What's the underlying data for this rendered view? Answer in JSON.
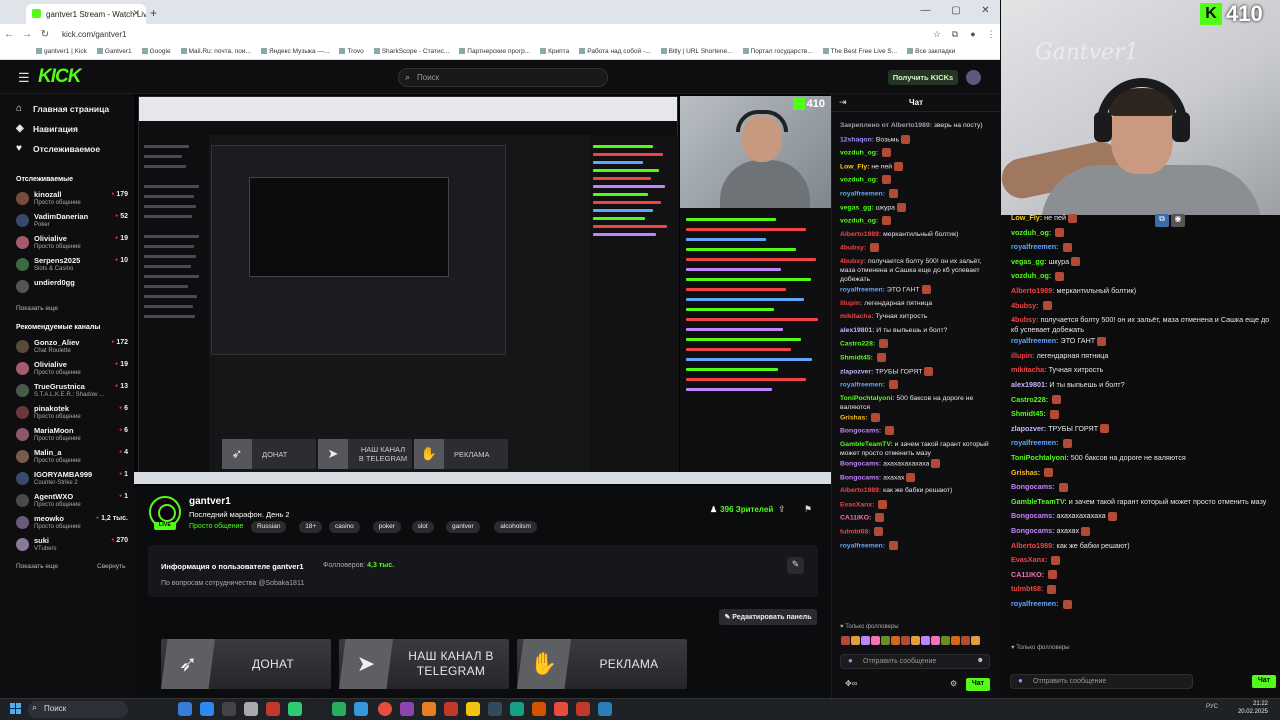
{
  "browser": {
    "tab_title": "gantver1 Stream - Watch Live",
    "new_tab": "+",
    "window_controls": [
      "—",
      "▢",
      "✕"
    ],
    "url": "kick.com/gantver1",
    "bookmarks": [
      "gantver1 | Kick",
      "Gantver1",
      "Google",
      "Mail.Ru: почта, пои...",
      "Яндекс Музыка —...",
      "Trovo",
      "SharkScope - Статис...",
      "Партнерские прогр...",
      "Крипта",
      "Работа над собой -...",
      "Bitly | URL Shortene...",
      "Портал государств...",
      "The Best Free Live S..."
    ],
    "bookmarks_all": "Все закладки"
  },
  "header": {
    "logo": "KICK",
    "search_placeholder": "Поиск",
    "get_kicks": "Получить KICKs"
  },
  "sidebar": {
    "nav": [
      {
        "label": "Главная страница",
        "icon": "home-icon"
      },
      {
        "label": "Навигация",
        "icon": "compass-icon"
      },
      {
        "label": "Отслеживаемое",
        "icon": "heart-icon"
      }
    ],
    "following_title": "Отслеживаемые",
    "following": [
      {
        "name": "kinozall",
        "category": "Просто общение",
        "viewers": "179",
        "color": "#7a4b3a"
      },
      {
        "name": "VadimDanerian",
        "category": "Poker",
        "viewers": "52",
        "color": "#384a6a"
      },
      {
        "name": "Olivialive",
        "category": "Просто общение",
        "viewers": "19",
        "color": "#a65b6d"
      },
      {
        "name": "Serpens2025",
        "category": "Slots & Casino",
        "viewers": "10",
        "color": "#3b6b3e"
      },
      {
        "name": "undierd0gg",
        "category": "",
        "viewers": "",
        "color": "#555555"
      }
    ],
    "show_more_1": "Показать еще",
    "recommended_title": "Рекомендуемые каналы",
    "recommended": [
      {
        "name": "Gonzo_Aliev",
        "category": "Chat Roulette",
        "viewers": "172",
        "color": "#5a4a3a"
      },
      {
        "name": "Olivialive",
        "category": "Просто общение",
        "viewers": "19",
        "color": "#a65b6d"
      },
      {
        "name": "TrueGrustnica",
        "category": "S.T.A.L.K.E.R.: Shadow ...",
        "viewers": "13",
        "color": "#4a5a4a"
      },
      {
        "name": "pinakotek",
        "category": "Просто общение",
        "viewers": "6",
        "color": "#6a3a3a"
      },
      {
        "name": "MariaMoon",
        "category": "Просто общение",
        "viewers": "6",
        "color": "#8a5a6a"
      },
      {
        "name": "Malin_a",
        "category": "Просто общение",
        "viewers": "4",
        "color": "#7a5a4a"
      },
      {
        "name": "IGORYAMBA999",
        "category": "Counter-Strike 2",
        "viewers": "1",
        "color": "#3a4a6a"
      },
      {
        "name": "AgentWXO",
        "category": "Просто общение",
        "viewers": "1",
        "color": "#4a4a4a"
      },
      {
        "name": "meowko",
        "category": "Просто общение",
        "viewers": "1,2 тыс.",
        "color": "#6a5a7a"
      },
      {
        "name": "suki",
        "category": "VTubers",
        "viewers": "270",
        "color": "#8a7a9a"
      }
    ],
    "show_more_2": "Показать еще",
    "collapse": "Свернуть"
  },
  "player": {
    "inner_badge": "410",
    "buttons": [
      "ДОНАТ",
      "НАШ КАНАЛ В TELEGRAM",
      "РЕКЛАМА"
    ]
  },
  "stream": {
    "streamer": "gantver1",
    "title": "Последний марафон. День 2",
    "category": "Просто общение",
    "tags": [
      "Russian",
      "18+",
      "casino",
      "poker",
      "slot",
      "gantver",
      "alcoholism"
    ],
    "viewers": "396 Зрителей",
    "live": "LIVE"
  },
  "about": {
    "title": "Информация о пользователе gantver1",
    "followers_label": "Фолловеров:",
    "followers_value": "4,3 тыс.",
    "description": "По вопросам сотрудничества @Sobaka1811",
    "edit_panel": "Редактировать панель"
  },
  "panels": [
    {
      "label": "ДОНАТ",
      "icon": "wing-icon"
    },
    {
      "label": "НАШ КАНАЛ В TELEGRAM",
      "icon": "telegram-icon"
    },
    {
      "label": "РЕКЛАМА",
      "icon": "handshake-icon"
    }
  ],
  "chat": {
    "title": "Чат",
    "messages": [
      {
        "user": "Закреплено от Alberto1989:",
        "text": "зверь на посту)",
        "color": "#9aa0a6"
      },
      {
        "user": "12shaqon:",
        "text": "Возьмь",
        "color": "#a78bfa"
      },
      {
        "user": "vozduh_og:",
        "text": "",
        "color": "#53fc18"
      },
      {
        "user": "Low_Fly:",
        "text": "не пей",
        "color": "#facc15"
      },
      {
        "user": "vozduh_og:",
        "text": "",
        "color": "#53fc18"
      },
      {
        "user": "royalfreemen:",
        "text": "",
        "color": "#60a5fa"
      },
      {
        "user": "vegas_gg:",
        "text": "шкура",
        "color": "#53fc18"
      },
      {
        "user": "vozduh_og:",
        "text": "",
        "color": "#53fc18"
      },
      {
        "user": "Alberto1989:",
        "text": "меркантильный болтик)",
        "color": "#ef4444"
      },
      {
        "user": "4bubsy:",
        "text": "",
        "color": "#ef4444"
      },
      {
        "user": "4bubsy:",
        "text": "получается болту 500! он их зальёт, маза отменена и Сашка еще до кб успевает добежать",
        "color": "#ef4444"
      },
      {
        "user": "royalfreemen:",
        "text": "ЭТО ГАНТ",
        "color": "#60a5fa"
      },
      {
        "user": "illupin:",
        "text": "легендарная пятница",
        "color": "#ef4444"
      },
      {
        "user": "mikitacha:",
        "text": "Тучная хитрость",
        "color": "#ef4444"
      },
      {
        "user": "alex19801:",
        "text": "И ты выпьешь и болт?",
        "color": "#c4b5fd"
      },
      {
        "user": "Castro228:",
        "text": "",
        "color": "#53fc18"
      },
      {
        "user": "Shmidt45:",
        "text": "",
        "color": "#53fc18"
      },
      {
        "user": "zlapozver:",
        "text": "ТРУБЫ ГОРЯТ",
        "color": "#c4b5fd"
      },
      {
        "user": "royalfreemen:",
        "text": "",
        "color": "#60a5fa"
      },
      {
        "user": "ToniPochtalyoni:",
        "text": "500 баксов на дороге не валяются",
        "color": "#53fc18"
      },
      {
        "user": "Grishas:",
        "text": "",
        "color": "#fbbf24"
      },
      {
        "user": "Bongocams:",
        "text": "",
        "color": "#c084fc"
      },
      {
        "user": "GambleTeamTV:",
        "text": "и зачем такой гарант который может просто отменить мазу",
        "color": "#53fc18"
      },
      {
        "user": "Bongocams:",
        "text": "ахахахахахаха",
        "color": "#c084fc"
      },
      {
        "user": "Bongocams:",
        "text": "ахахах",
        "color": "#c084fc"
      },
      {
        "user": "Alberto1989:",
        "text": "как же бабки решают)",
        "color": "#ef4444"
      },
      {
        "user": "EvasXanx:",
        "text": "",
        "color": "#ef4444"
      },
      {
        "user": "CA11IKO:",
        "text": "",
        "color": "#f472b6"
      },
      {
        "user": "tulmbt68:",
        "text": "",
        "color": "#ef4444"
      },
      {
        "user": "royalfreemen:",
        "text": "",
        "color": "#60a5fa"
      }
    ],
    "followers_only": "Только фолловеры",
    "input_placeholder": "Отправить сообщение",
    "send": "Чат"
  },
  "overlay": {
    "counter": "410",
    "watermark": "Gantver1",
    "messages": [
      {
        "user": "Low_Fly:",
        "text": "не пей",
        "color": "#facc15"
      },
      {
        "user": "vozduh_og:",
        "text": "",
        "color": "#53fc18"
      },
      {
        "user": "royalfreemen:",
        "text": "",
        "color": "#60a5fa"
      },
      {
        "user": "vegas_gg:",
        "text": "шкура",
        "color": "#53fc18"
      },
      {
        "user": "vozduh_og:",
        "text": "",
        "color": "#53fc18"
      },
      {
        "user": "Alberto1989:",
        "text": "меркантильный болтик)",
        "color": "#ef4444"
      },
      {
        "user": "4bubsy:",
        "text": "",
        "color": "#ef4444"
      },
      {
        "user": "4bubsy:",
        "text": "получается болту 500! он их зальёт, маза отменена и Сашка еще до кб успевает добежать",
        "color": "#ef4444"
      },
      {
        "user": "royalfreemen:",
        "text": "ЭТО ГАНТ",
        "color": "#60a5fa"
      },
      {
        "user": "illupin:",
        "text": "легендарная пятница",
        "color": "#ef4444"
      },
      {
        "user": "mikitacha:",
        "text": "Тучная хитрость",
        "color": "#ef4444"
      },
      {
        "user": "alex19801:",
        "text": "И ты выпьешь и болт?",
        "color": "#c4b5fd"
      },
      {
        "user": "Castro228:",
        "text": "",
        "color": "#53fc18"
      },
      {
        "user": "Shmidt45:",
        "text": "",
        "color": "#53fc18"
      },
      {
        "user": "zlapozver:",
        "text": "ТРУБЫ ГОРЯТ",
        "color": "#c4b5fd"
      },
      {
        "user": "royalfreemen:",
        "text": "",
        "color": "#60a5fa"
      },
      {
        "user": "ToniPochtalyoni:",
        "text": "500 баксов на дороге не валяются",
        "color": "#53fc18"
      },
      {
        "user": "Grishas:",
        "text": "",
        "color": "#fbbf24"
      },
      {
        "user": "Bongocams:",
        "text": "",
        "color": "#c084fc"
      },
      {
        "user": "GambleTeamTV:",
        "text": "и зачем такой гарант который может просто отменить мазу",
        "color": "#53fc18"
      },
      {
        "user": "Bongocams:",
        "text": "ахахахахахаха",
        "color": "#c084fc"
      },
      {
        "user": "Bongocams:",
        "text": "ахахах",
        "color": "#c084fc"
      },
      {
        "user": "Alberto1989:",
        "text": "как же бабки решают)",
        "color": "#ef4444"
      },
      {
        "user": "EvasXanx:",
        "text": "",
        "color": "#ef4444"
      },
      {
        "user": "CA11IKO:",
        "text": "",
        "color": "#f472b6"
      },
      {
        "user": "tulmbt68:",
        "text": "",
        "color": "#ef4444"
      },
      {
        "user": "royalfreemen:",
        "text": "",
        "color": "#60a5fa"
      }
    ],
    "followers_only": "Только фолловеры",
    "input_placeholder": "Отправить сообщение",
    "send": "Чат"
  },
  "taskbar": {
    "search": "Поиск",
    "lang": "РУС",
    "time": "21:22",
    "date": "20.02.2025"
  }
}
